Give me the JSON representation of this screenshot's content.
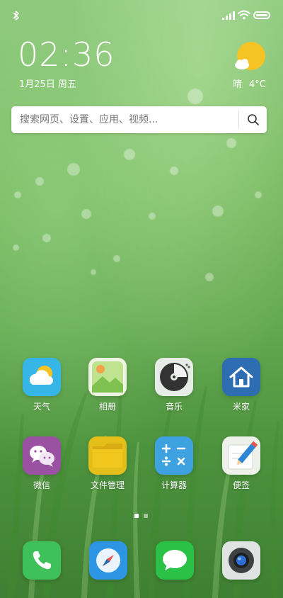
{
  "status_bar": {
    "bluetooth_icon": "bluetooth-icon",
    "signal_icon": "signal-icon",
    "wifi_icon": "wifi-icon",
    "battery_icon": "battery-icon"
  },
  "clock": {
    "time": "02:36",
    "date": "1月25日 周五"
  },
  "weather": {
    "condition": "晴",
    "temperature": "4°C",
    "icon": "sunny-cloud-icon"
  },
  "search": {
    "placeholder": "搜索网页、设置、应用、视频...",
    "icon": "search-icon"
  },
  "apps": [
    {
      "label": "天气",
      "icon": "weather-app-icon",
      "color": "#35b6e6"
    },
    {
      "label": "相册",
      "icon": "gallery-icon",
      "color": "#b3df86"
    },
    {
      "label": "音乐",
      "icon": "music-icon",
      "color": "#e8ece6"
    },
    {
      "label": "米家",
      "icon": "mijia-home-icon",
      "color": "#2e6db1"
    },
    {
      "label": "微信",
      "icon": "wechat-icon",
      "color": "#9b51a2"
    },
    {
      "label": "文件管理",
      "icon": "folder-icon",
      "color": "#e4bf1a"
    },
    {
      "label": "计算器",
      "icon": "calculator-icon",
      "color": "#3ea2e0"
    },
    {
      "label": "便签",
      "icon": "notes-icon",
      "color": "#eef1ea"
    }
  ],
  "page_indicator": {
    "pages": 2,
    "current": 1
  },
  "dock": [
    {
      "name": "phone",
      "icon": "phone-icon",
      "color": "#3ec05a"
    },
    {
      "name": "browser",
      "icon": "compass-icon",
      "color": "#2e95e5"
    },
    {
      "name": "messages",
      "icon": "message-icon",
      "color": "#2bc046"
    },
    {
      "name": "camera",
      "icon": "camera-icon",
      "color": "#dfe3e1"
    }
  ]
}
